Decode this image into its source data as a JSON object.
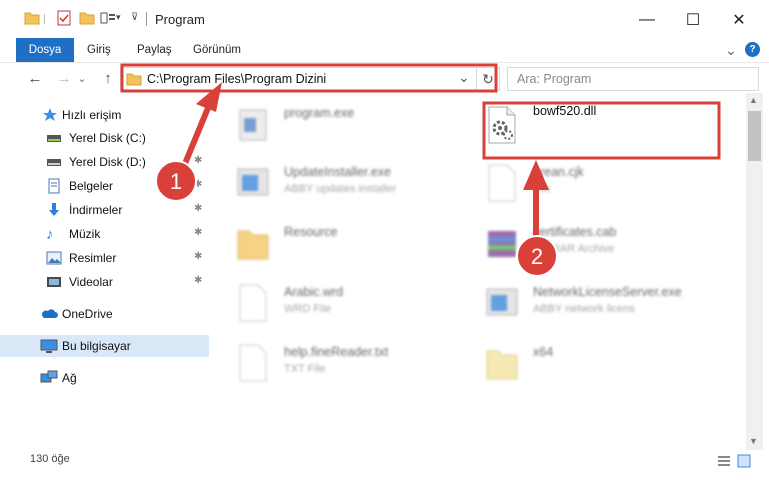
{
  "window": {
    "title": "Program",
    "minimize_glyph": "—",
    "maximize_glyph": "☐",
    "close_glyph": "✕"
  },
  "ribbon": {
    "tabs": [
      "Dosya",
      "Giriş",
      "Paylaş",
      "Görünüm"
    ],
    "expand_glyph": "⌄",
    "help_glyph": "?"
  },
  "address_bar": {
    "back_glyph": "←",
    "forward_glyph": "→",
    "recent_glyph": "⌄",
    "up_glyph": "↑",
    "path": "C:\\Program Files\\Program Dizini",
    "dropdown_glyph": "⌄",
    "refresh_glyph": "↻",
    "search_placeholder": "Ara: Program"
  },
  "nav_pane": {
    "items": [
      {
        "label": "Hızlı erişim",
        "icon": "star-icon",
        "pinned": false
      },
      {
        "label": "Yerel Disk (C:)",
        "icon": "drive-icon",
        "pinned": false
      },
      {
        "label": "Yerel Disk (D:)",
        "icon": "drive-icon",
        "pinned": true
      },
      {
        "label": "Belgeler",
        "icon": "documents-icon",
        "pinned": true
      },
      {
        "label": "İndirmeler",
        "icon": "downloads-icon",
        "pinned": true
      },
      {
        "label": "Müzik",
        "icon": "music-icon",
        "pinned": true
      },
      {
        "label": "Resimler",
        "icon": "pictures-icon",
        "pinned": true
      },
      {
        "label": "Videolar",
        "icon": "videos-icon",
        "pinned": true
      },
      {
        "label": "OneDrive",
        "icon": "cloud-icon",
        "pinned": false
      },
      {
        "label": "Bu bilgisayar",
        "icon": "computer-icon",
        "pinned": false
      },
      {
        "label": "Ağ",
        "icon": "network-icon",
        "pinned": false
      }
    ],
    "pin_glyph": "📌"
  },
  "files": [
    {
      "name": "program.exe",
      "type": "",
      "icon": "exe-icon"
    },
    {
      "name": "bowf520.dll",
      "type": "",
      "icon": "dll-gear-icon"
    },
    {
      "name": "UpdateInstaller.exe",
      "type": "ABBY updates installer",
      "icon": "installer-icon"
    },
    {
      "name": "erean.cjk",
      "type": "File",
      "icon": "file-icon"
    },
    {
      "name": "Resource",
      "type": "",
      "icon": "folder-icon"
    },
    {
      "name": "certificates.cab",
      "type": "WinRAR Archive",
      "icon": "archive-icon"
    },
    {
      "name": "Arabic.wrd",
      "type": "WRD File",
      "icon": "file-icon"
    },
    {
      "name": "NetworkLicenseServer.exe",
      "type": "ABBY network licens",
      "icon": "installer-icon"
    },
    {
      "name": "help.fineReader.txt",
      "type": "TXT File",
      "icon": "file-icon"
    },
    {
      "name": "x64",
      "type": "",
      "icon": "folder-icon"
    }
  ],
  "annotations": {
    "marker_1": "1",
    "marker_2": "2",
    "highlight_color": "#d9403a"
  },
  "status_bar": {
    "item_count": "130 öğe"
  }
}
